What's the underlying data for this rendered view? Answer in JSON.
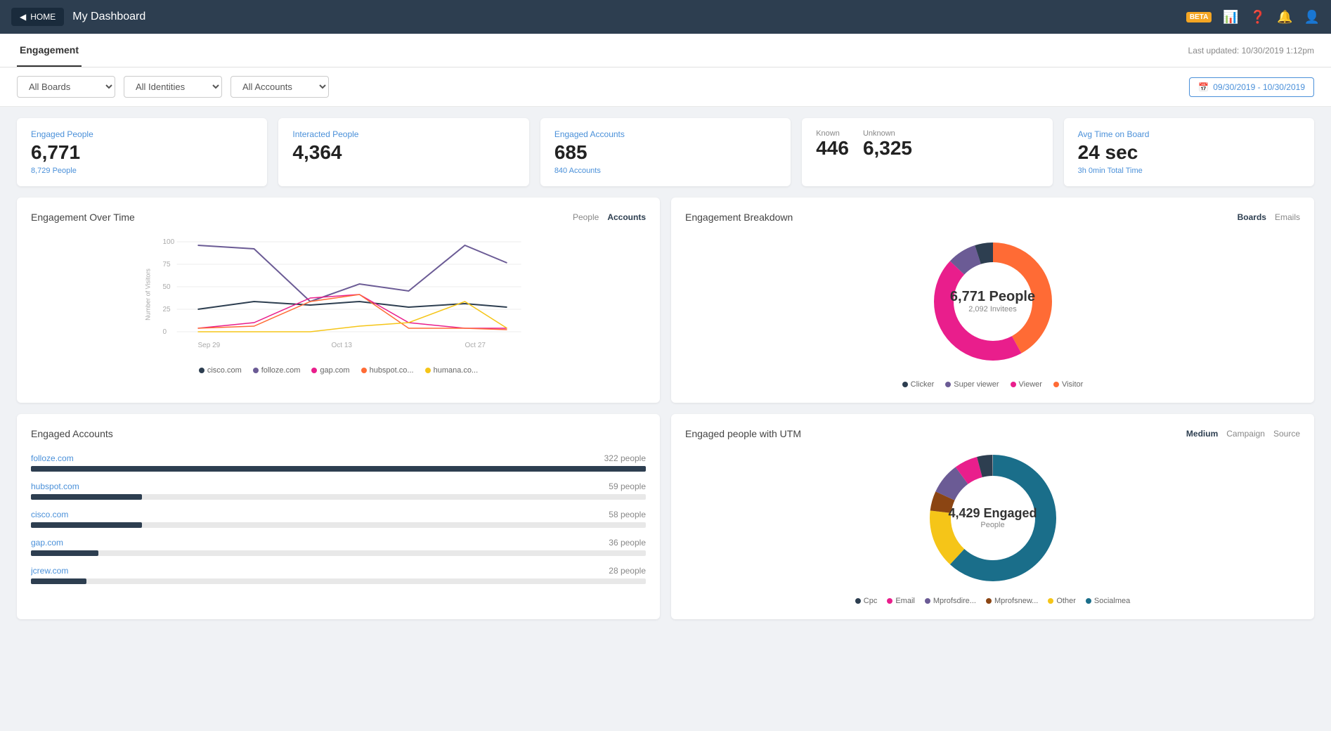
{
  "topnav": {
    "home_label": "HOME",
    "page_title": "My Dashboard",
    "beta_label": "BETA"
  },
  "subheader": {
    "tab_label": "Engagement",
    "last_updated": "Last updated: 10/30/2019 1:12pm"
  },
  "filters": {
    "boards_label": "All Boards",
    "identities_label": "All Identities",
    "accounts_label": "All Accounts",
    "date_range": "09/30/2019 - 10/30/2019"
  },
  "kpis": {
    "engaged_people": {
      "label": "Engaged People",
      "value": "6,771",
      "sub": "8,729 People"
    },
    "interacted_people": {
      "label": "Interacted People",
      "value": "4,364",
      "sub": ""
    },
    "engaged_accounts": {
      "label": "Engaged Accounts",
      "value": "685",
      "sub": "840 Accounts"
    },
    "known_unknown": {
      "known_label": "Known",
      "known_value": "446",
      "unknown_label": "Unknown",
      "unknown_value": "6,325"
    },
    "avg_time": {
      "label": "Avg Time on Board",
      "value": "24 sec",
      "sub": "3h 0min  Total Time"
    }
  },
  "engagement_over_time": {
    "title": "Engagement Over Time",
    "tabs": [
      "People",
      "Accounts"
    ],
    "active_tab": "Accounts",
    "y_label": "Number of Visitors",
    "x_labels": [
      "Sep 29",
      "Oct 13",
      "Oct 27"
    ],
    "legend": [
      {
        "label": "cisco.com",
        "color": "#2d3e50"
      },
      {
        "label": "folloze.com",
        "color": "#6b5b95"
      },
      {
        "label": "gap.com",
        "color": "#e91e8c"
      },
      {
        "label": "hubspot.co...",
        "color": "#ff6b35"
      },
      {
        "label": "humana.co...",
        "color": "#f5c518"
      }
    ]
  },
  "engagement_breakdown": {
    "title": "Engagement Breakdown",
    "tabs": [
      "Boards",
      "Emails"
    ],
    "active_tab": "Boards",
    "center_value": "6,771 People",
    "center_sub": "2,092 Invitees",
    "segments": [
      {
        "label": "Clicker",
        "color": "#2d3e50",
        "value": 5
      },
      {
        "label": "Super viewer",
        "color": "#6b5b95",
        "value": 8
      },
      {
        "label": "Viewer",
        "color": "#e91e8c",
        "value": 45
      },
      {
        "label": "Visitor",
        "color": "#ff6b35",
        "value": 42
      }
    ]
  },
  "engaged_accounts": {
    "title": "Engaged Accounts",
    "items": [
      {
        "name": "folloze.com",
        "count": "322 people",
        "pct": 100
      },
      {
        "name": "hubspot.com",
        "count": "59 people",
        "pct": 18
      },
      {
        "name": "cisco.com",
        "count": "58 people",
        "pct": 18
      },
      {
        "name": "gap.com",
        "count": "36 people",
        "pct": 11
      },
      {
        "name": "jcrew.com",
        "count": "28 people",
        "pct": 9
      }
    ]
  },
  "utm": {
    "title": "Engaged people with UTM",
    "tabs": [
      "Medium",
      "Campaign",
      "Source"
    ],
    "active_tab": "Medium",
    "center_value": "4,429 Engaged",
    "center_sub": "People",
    "segments": [
      {
        "label": "Cpc",
        "color": "#2d3e50",
        "value": 4
      },
      {
        "label": "Email",
        "color": "#e91e8c",
        "value": 6
      },
      {
        "label": "Mprofsdire...",
        "color": "#6b5b95",
        "value": 8
      },
      {
        "label": "Mprofsnew...",
        "color": "#8b4513",
        "value": 5
      },
      {
        "label": "Other",
        "color": "#f5c518",
        "value": 15
      },
      {
        "label": "Socialmea",
        "color": "#1a6e8a",
        "value": 62
      }
    ]
  }
}
